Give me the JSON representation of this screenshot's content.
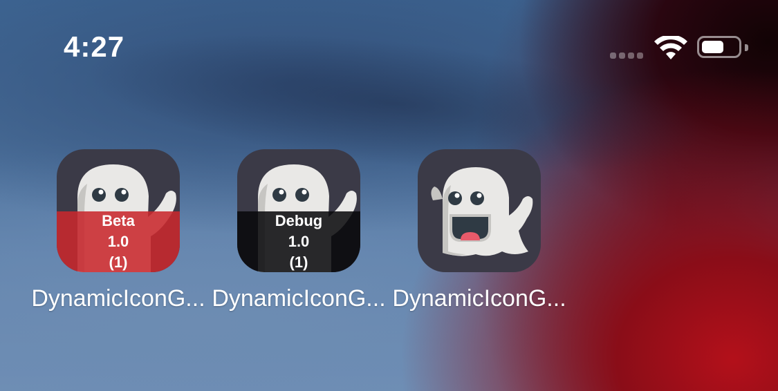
{
  "status_bar": {
    "time": "4:27",
    "signal_icon": "cellular-signal-icon",
    "wifi_icon": "wifi-icon",
    "battery_icon": "battery-icon",
    "battery_level": 0.6
  },
  "apps": [
    {
      "label": "DynamicIconG...",
      "icon": "ghost-icon",
      "badge": {
        "variant": "Beta",
        "version": "1.0",
        "build": "(1)",
        "color": "#c8282d"
      }
    },
    {
      "label": "DynamicIconG...",
      "icon": "ghost-icon",
      "badge": {
        "variant": "Debug",
        "version": "1.0",
        "build": "(1)",
        "color": "#08080a"
      }
    },
    {
      "label": "DynamicIconG...",
      "icon": "ghost-icon"
    }
  ],
  "colors": {
    "icon_background": "#3b3a47",
    "ghost_body": "#e9e8e6",
    "ghost_shadow": "#c6c5c2",
    "mouth": "#2f3a44",
    "tongue": "#e85a6a"
  }
}
